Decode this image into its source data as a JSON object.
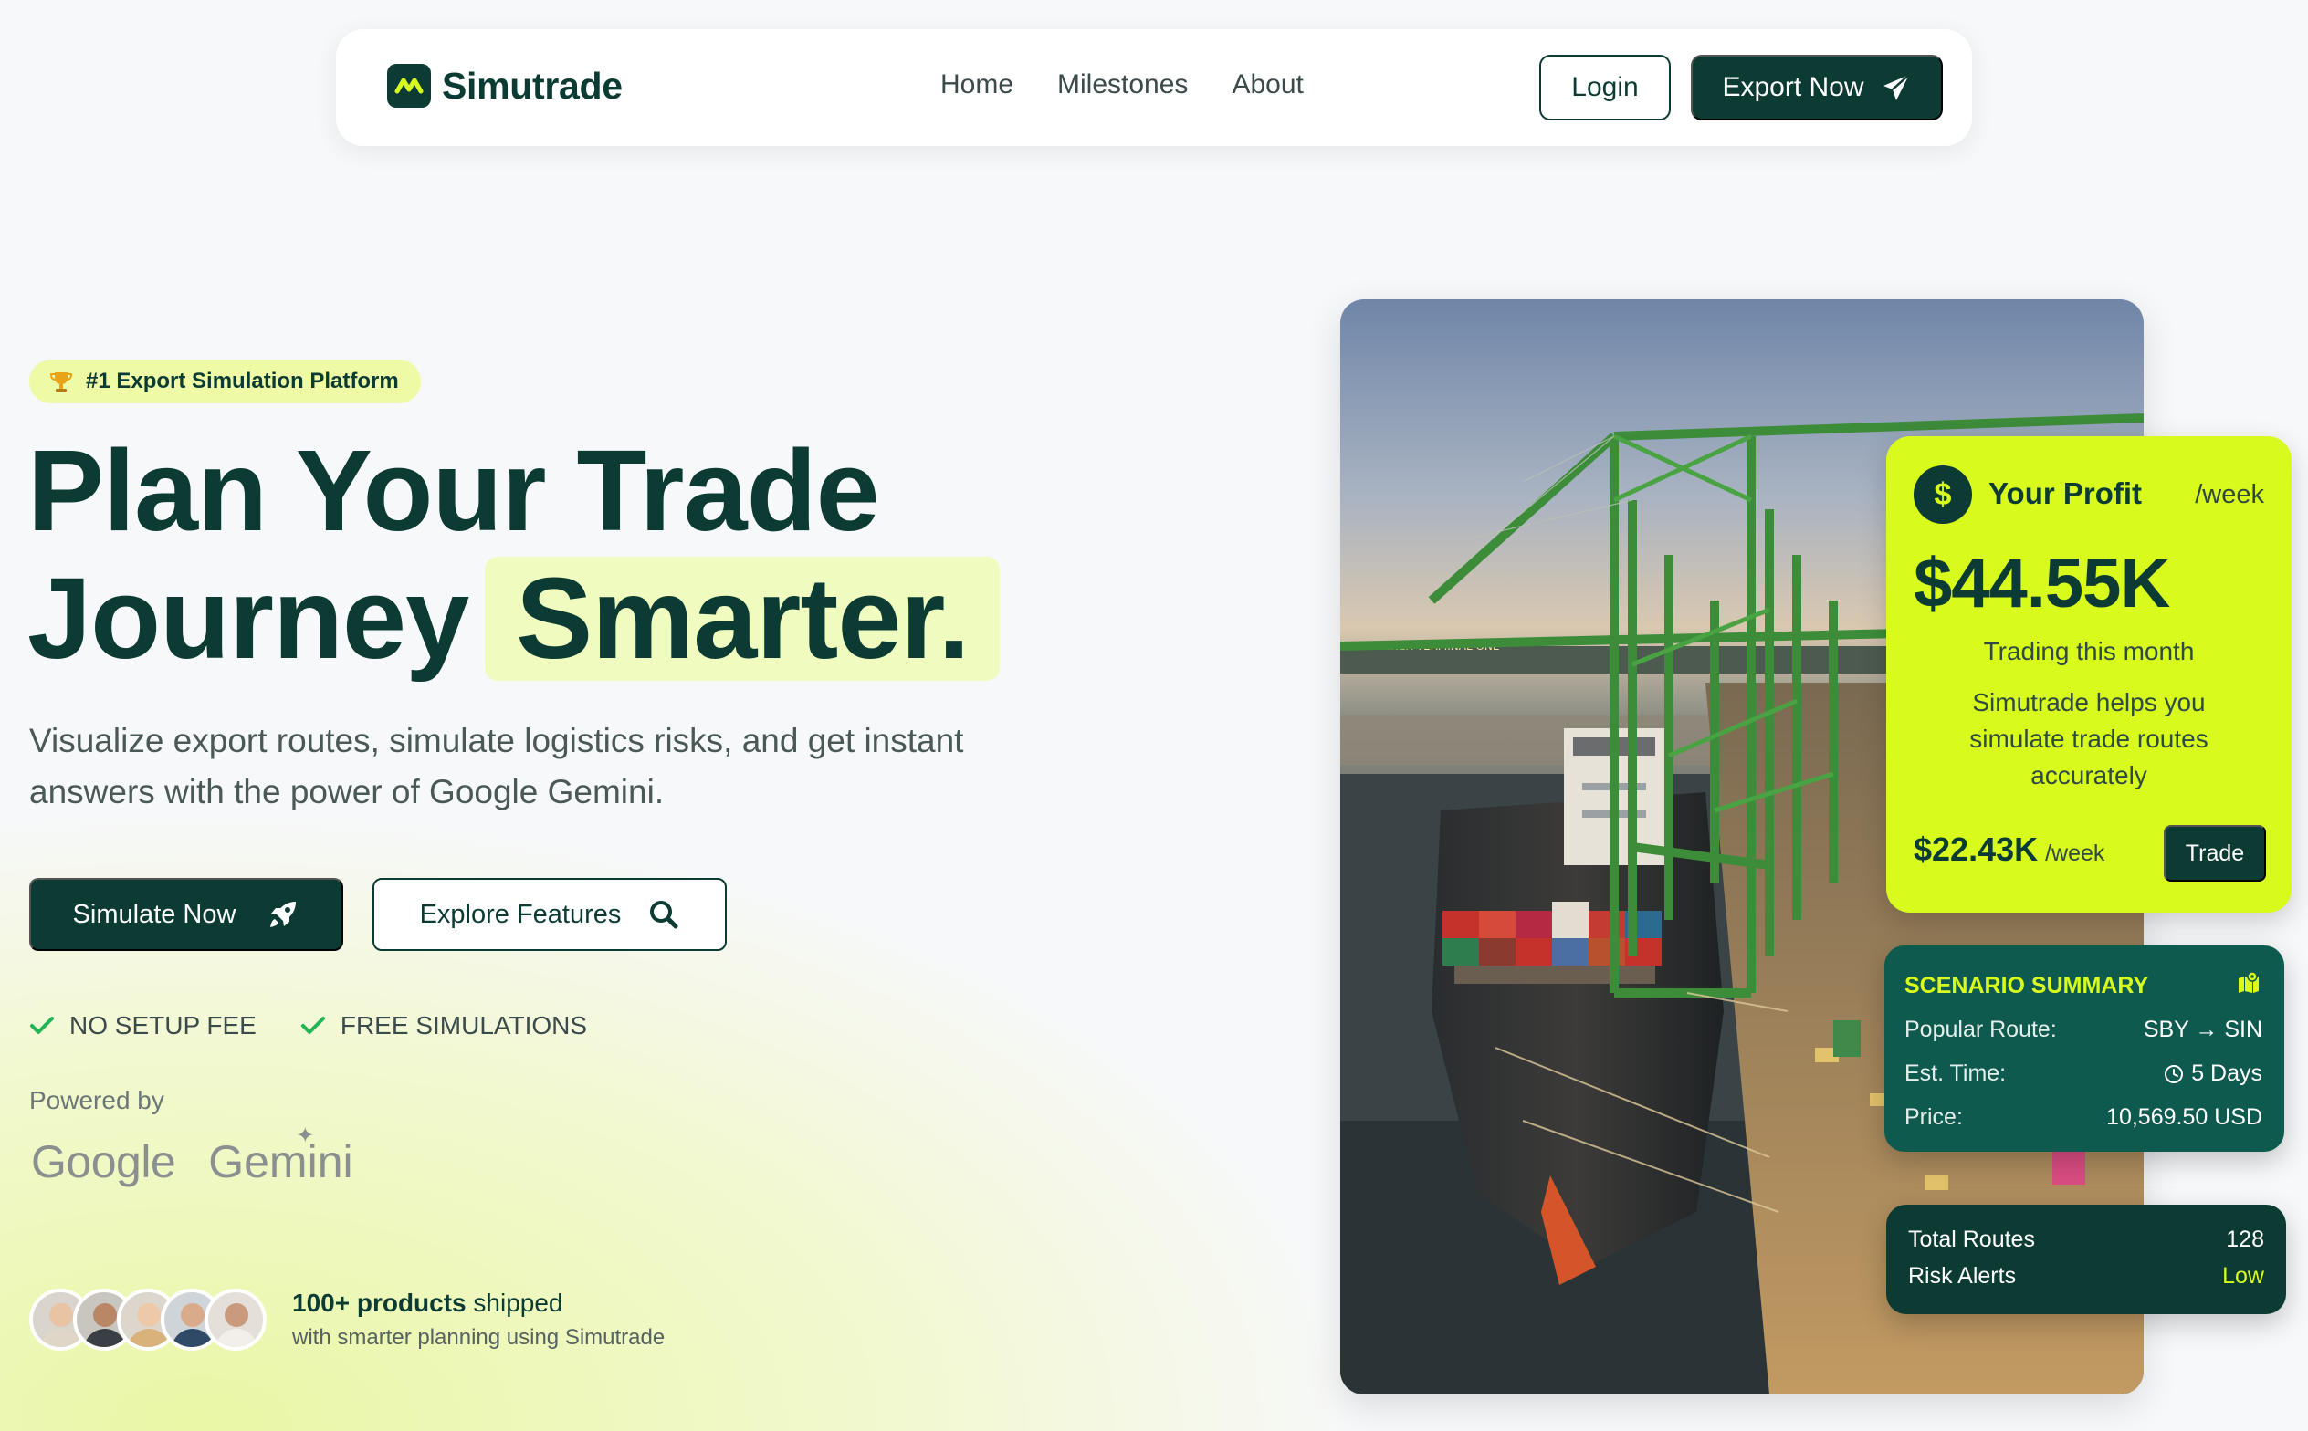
{
  "nav": {
    "brand": "Simutrade",
    "links": [
      "Home",
      "Milestones",
      "About"
    ],
    "login_label": "Login",
    "export_label": "Export Now"
  },
  "hero": {
    "badge_icon": "trophy-icon",
    "badge": "#1 Export Simulation Platform",
    "title_line1": "Plan Your Trade",
    "title_line2_start": "Journey",
    "title_highlight": "Smarter.",
    "subtitle": "Visualize export routes, simulate logistics risks, and get instant answers with the power of Google Gemini.",
    "simulate_label": "Simulate Now",
    "explore_label": "Explore Features",
    "checks": [
      "NO SETUP FEE",
      "FREE SIMULATIONS"
    ],
    "powered_by": "Powered by",
    "partner_google": "Google",
    "partner_gemini": "Gemini",
    "shipped_bold": "100+ products",
    "shipped_rest": " shipped",
    "shipped_sub": "with smarter planning using Simutrade"
  },
  "profit": {
    "title": "Your Profit",
    "period": "/week",
    "amount": "$44.55K",
    "label": "Trading this month",
    "description": "Simutrade helps you simulate trade routes accurately",
    "weekly_amount": "$22.43K",
    "weekly_period": "/week",
    "trade_label": "Trade"
  },
  "scenario": {
    "title": "SCENARIO SUMMARY",
    "rows": [
      {
        "label": "Popular Route:",
        "value": "SBY → SIN"
      },
      {
        "label": "Est. Time:",
        "value": "5 Days"
      },
      {
        "label": "Price:",
        "value": "10,569.50 USD"
      }
    ]
  },
  "totals": {
    "routes_label": "Total Routes",
    "routes_value": "128",
    "risk_label": "Risk Alerts",
    "risk_value": "Low"
  },
  "colors": {
    "primary": "#0b3b33",
    "accent": "#d8fa1c",
    "scenario_bg": "#0f5a4f",
    "highlight_bg": "#f0fbc0",
    "check_green": "#22b455"
  }
}
